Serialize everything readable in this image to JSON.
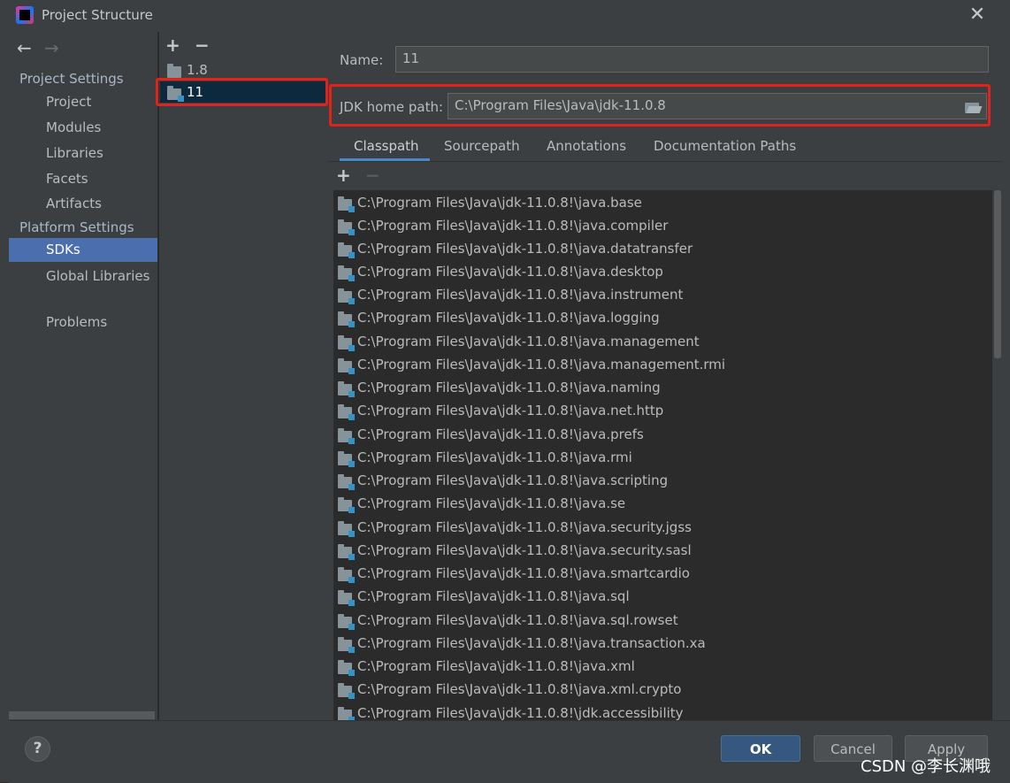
{
  "window": {
    "title": "Project Structure",
    "close_icon": "close-icon",
    "app_icon": "intellij-idea-icon"
  },
  "nav": {
    "back": "←",
    "forward": "→"
  },
  "left_nav": {
    "project_settings_header": "Project Settings",
    "platform_settings_header": "Platform Settings",
    "items": [
      {
        "label": "Project"
      },
      {
        "label": "Modules"
      },
      {
        "label": "Libraries"
      },
      {
        "label": "Facets"
      },
      {
        "label": "Artifacts"
      },
      {
        "label": "SDKs",
        "selected": true
      },
      {
        "label": "Global Libraries"
      },
      {
        "label": "Problems"
      }
    ]
  },
  "sdk_list": {
    "add": "+",
    "remove": "−",
    "items": [
      {
        "label": "1.8"
      },
      {
        "label": "11",
        "selected": true
      }
    ]
  },
  "sdk_details": {
    "name_label": "Name:",
    "name_value": "11",
    "jdk_home_label": "JDK home path:",
    "jdk_home_value": "C:\\Program Files\\Java\\jdk-11.0.8",
    "tabs": [
      "Classpath",
      "Sourcepath",
      "Annotations",
      "Documentation Paths"
    ],
    "active_tab": "Classpath",
    "list_add": "+",
    "list_remove": "−",
    "classpath": [
      "C:\\Program Files\\Java\\jdk-11.0.8!\\java.base",
      "C:\\Program Files\\Java\\jdk-11.0.8!\\java.compiler",
      "C:\\Program Files\\Java\\jdk-11.0.8!\\java.datatransfer",
      "C:\\Program Files\\Java\\jdk-11.0.8!\\java.desktop",
      "C:\\Program Files\\Java\\jdk-11.0.8!\\java.instrument",
      "C:\\Program Files\\Java\\jdk-11.0.8!\\java.logging",
      "C:\\Program Files\\Java\\jdk-11.0.8!\\java.management",
      "C:\\Program Files\\Java\\jdk-11.0.8!\\java.management.rmi",
      "C:\\Program Files\\Java\\jdk-11.0.8!\\java.naming",
      "C:\\Program Files\\Java\\jdk-11.0.8!\\java.net.http",
      "C:\\Program Files\\Java\\jdk-11.0.8!\\java.prefs",
      "C:\\Program Files\\Java\\jdk-11.0.8!\\java.rmi",
      "C:\\Program Files\\Java\\jdk-11.0.8!\\java.scripting",
      "C:\\Program Files\\Java\\jdk-11.0.8!\\java.se",
      "C:\\Program Files\\Java\\jdk-11.0.8!\\java.security.jgss",
      "C:\\Program Files\\Java\\jdk-11.0.8!\\java.security.sasl",
      "C:\\Program Files\\Java\\jdk-11.0.8!\\java.smartcardio",
      "C:\\Program Files\\Java\\jdk-11.0.8!\\java.sql",
      "C:\\Program Files\\Java\\jdk-11.0.8!\\java.sql.rowset",
      "C:\\Program Files\\Java\\jdk-11.0.8!\\java.transaction.xa",
      "C:\\Program Files\\Java\\jdk-11.0.8!\\java.xml",
      "C:\\Program Files\\Java\\jdk-11.0.8!\\java.xml.crypto",
      "C:\\Program Files\\Java\\jdk-11.0.8!\\jdk.accessibility"
    ]
  },
  "footer": {
    "help": "?",
    "ok": "OK",
    "cancel": "Cancel",
    "apply": "Apply"
  },
  "watermark": "CSDN @李长渊哦",
  "colors": {
    "highlight_box": "#e0241b",
    "selection": "#4b6eaf",
    "ok_button": "#365880"
  }
}
